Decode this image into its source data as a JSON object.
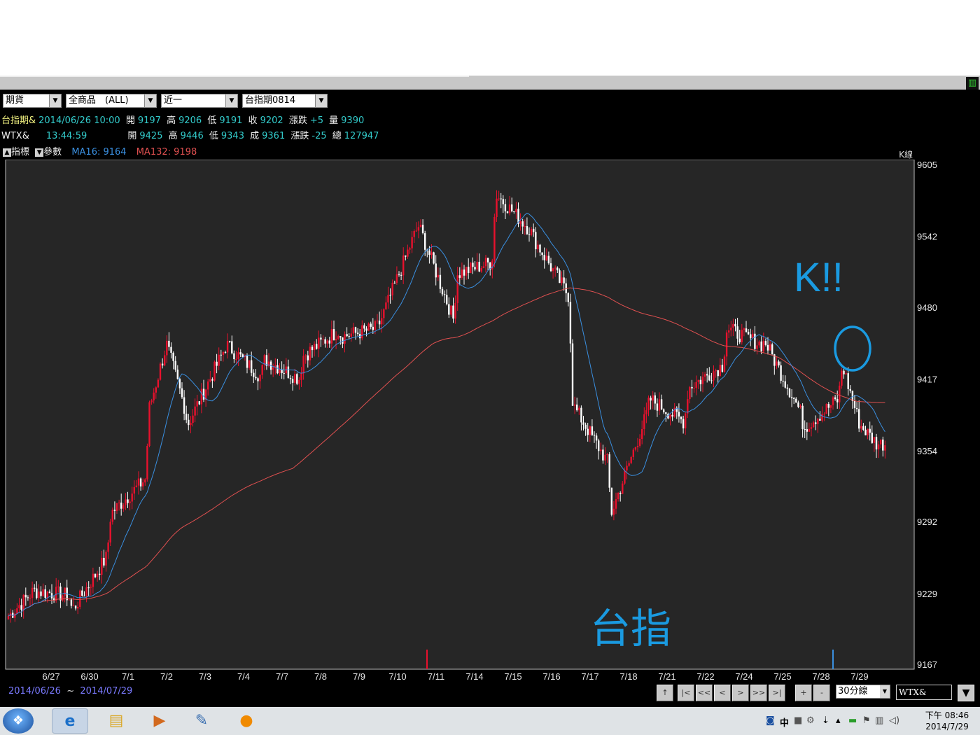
{
  "toolbar": {
    "combo1": "期貨",
    "combo2": "全商品　(ALL)",
    "combo3": "近一",
    "combo4": "台指期0814"
  },
  "quote1": {
    "name": "台指期&",
    "datetime": "2014/06/26 10:00",
    "open_label": "開",
    "open": "9197",
    "high_label": "高",
    "high": "9206",
    "low_label": "低",
    "low": "9191",
    "close_label": "收",
    "close": "9202",
    "chg_label": "漲跌",
    "chg": "+5",
    "vol_label": "量",
    "vol": "9390"
  },
  "quote2": {
    "name": "WTX&",
    "time": "13:44:59",
    "open_label": "開",
    "open": "9425",
    "high_label": "高",
    "high": "9446",
    "low_label": "低",
    "low": "9343",
    "close_label": "成",
    "close": "9361",
    "chg_label": "漲跌",
    "chg": "-25",
    "total_label": "總",
    "total": "127947"
  },
  "indicator_bar": {
    "btn1": "指標",
    "btn2": "參數",
    "ma16_label": "MA16:",
    "ma16": "9164",
    "ma132_label": "MA132:",
    "ma132": "9198",
    "chart_kind": "K線"
  },
  "colors": {
    "up_candle": "#e8112d",
    "down_candle": "#ffffff",
    "ma16": "#3a8fe0",
    "ma132": "#e05050",
    "background": "#262626",
    "annotation": "#1a9ae0"
  },
  "chart_data": {
    "type": "candlestick",
    "interval": "30分線",
    "ylim": [
      9167,
      9605
    ],
    "y_ticks": [
      "9605",
      "9542",
      "9480",
      "9417",
      "9354",
      "9292",
      "9229",
      "9167"
    ],
    "x_ticks": [
      "6/27",
      "6/30",
      "7/1",
      "7/2",
      "7/3",
      "7/4",
      "7/7",
      "7/8",
      "7/9",
      "7/10",
      "7/11",
      "7/14",
      "7/15",
      "7/16",
      "7/17",
      "7/18",
      "7/21",
      "7/22",
      "7/24",
      "7/25",
      "7/28",
      "7/29"
    ],
    "close_path": [
      [
        "6/26",
        9210
      ],
      [
        "6/27",
        9232
      ],
      [
        "6/27",
        9228
      ],
      [
        "6/30",
        9215
      ],
      [
        "6/30",
        9262
      ],
      [
        "7/1",
        9300
      ],
      [
        "7/1",
        9330
      ],
      [
        "7/2",
        9392
      ],
      [
        "7/2",
        9448
      ],
      [
        "7/2",
        9395
      ],
      [
        "7/3",
        9378
      ],
      [
        "7/3",
        9440
      ],
      [
        "7/4",
        9448
      ],
      [
        "7/4",
        9420
      ],
      [
        "7/7",
        9435
      ],
      [
        "7/7",
        9418
      ],
      [
        "7/8",
        9438
      ],
      [
        "7/8",
        9460
      ],
      [
        "7/9",
        9455
      ],
      [
        "7/9",
        9462
      ],
      [
        "7/10",
        9468
      ],
      [
        "7/10",
        9545
      ],
      [
        "7/11",
        9552
      ],
      [
        "7/11",
        9470
      ],
      [
        "7/14",
        9510
      ],
      [
        "7/14",
        9520
      ],
      [
        "7/15",
        9580
      ],
      [
        "7/15",
        9548
      ],
      [
        "7/16",
        9540
      ],
      [
        "7/16",
        9490
      ],
      [
        "7/17",
        9395
      ],
      [
        "7/17",
        9345
      ],
      [
        "7/18",
        9300
      ],
      [
        "7/18",
        9385
      ],
      [
        "7/21",
        9400
      ],
      [
        "7/21",
        9380
      ],
      [
        "7/22",
        9410
      ],
      [
        "7/22",
        9430
      ],
      [
        "7/24",
        9462
      ],
      [
        "7/24",
        9448
      ],
      [
        "7/25",
        9450
      ],
      [
        "7/25",
        9390
      ],
      [
        "7/28",
        9375
      ],
      [
        "7/28",
        9400
      ],
      [
        "7/29",
        9430
      ],
      [
        "7/29",
        9378
      ],
      [
        "7/29",
        9361
      ]
    ],
    "ma16_label": "MA16",
    "ma132_label": "MA132",
    "date_range": {
      "from": "2014/06/26",
      "sep": "~",
      "to": "2014/07/29"
    }
  },
  "annotations": {
    "k_note": "K!!",
    "taizhi": "台指"
  },
  "navbar": {
    "up": "↑",
    "first": "|<",
    "prev_page": "<<",
    "prev": "<",
    "next": ">",
    "next_page": ">>",
    "last": ">|",
    "zoom_in": "+",
    "zoom_out": "-",
    "interval": "30分線",
    "symbol": "WTX&"
  },
  "taskbar": {
    "ime": "中",
    "clock_line1": "下午 08:46",
    "clock_line2": "2014/7/29"
  }
}
